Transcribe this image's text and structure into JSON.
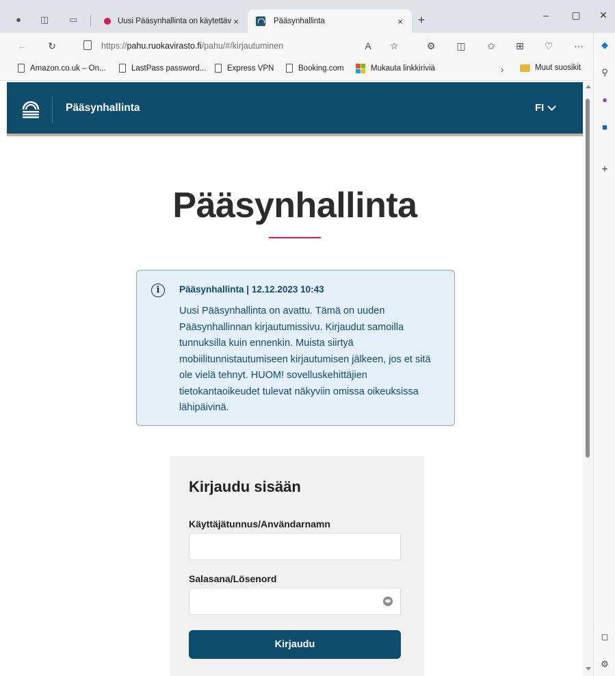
{
  "browser": {
    "tabs": [
      {
        "title": "Uusi Pääsynhallinta on käytettävissä",
        "active": false
      },
      {
        "title": "Pääsynhallinta",
        "active": true
      }
    ],
    "address": {
      "prefix": "https://",
      "domain": "pahu.ruokavirasto.fi",
      "path": "/pahu/#/kirjautuminen"
    },
    "bookmarks": [
      {
        "label": "Amazon.co.uk – On..."
      },
      {
        "label": "LastPass password..."
      },
      {
        "label": "Express VPN"
      },
      {
        "label": "Booking.com"
      },
      {
        "label": "Mukauta linkkiriviä"
      }
    ],
    "other_favorites": "Muut suosikit",
    "icons": {
      "close": "×",
      "new_tab": "+",
      "minimize": "–",
      "maximize": "▢",
      "window_close": "✕",
      "back": "←",
      "refresh": "↻",
      "read_aloud": "A",
      "favorite": "☆",
      "extensions": "⚙",
      "split": "◫",
      "favorites": "✩",
      "collections": "⊞",
      "performance": "♡",
      "more": "···",
      "chevron": "›",
      "search": "⚲",
      "add": "+",
      "panel": "◻",
      "settings": "⚙"
    }
  },
  "app": {
    "header_title": "Pääsynhallinta",
    "language": "FI",
    "page_title": "Pääsynhallinta",
    "accent_color": "#0d4c6c",
    "highlight_color": "#d51a5a",
    "notice": {
      "icon": "i",
      "heading": "Pääsynhallinta | 12.12.2023 10:43",
      "body": "Uusi Pääsynhallinta on avattu. Tämä on uuden Pääsynhallinnan kirjautumissivu. Kirjaudut samoilla tunnuksilla kuin ennenkin. Muista siirtyä mobiilitunnistautumiseen kirjautumisen jälkeen, jos et sitä ole vielä tehnyt. HUOM! sovelluskehittäjien tietokantaoikeudet tulevat näkyviin omissa oikeuksissa lähipäivinä."
    },
    "login": {
      "title": "Kirjaudu sisään",
      "username_label": "Käyttäjätunnus/Användarnamn",
      "username_value": "",
      "password_label": "Salasana/Lösenord",
      "password_value": "",
      "submit_label": "Kirjaudu"
    }
  }
}
